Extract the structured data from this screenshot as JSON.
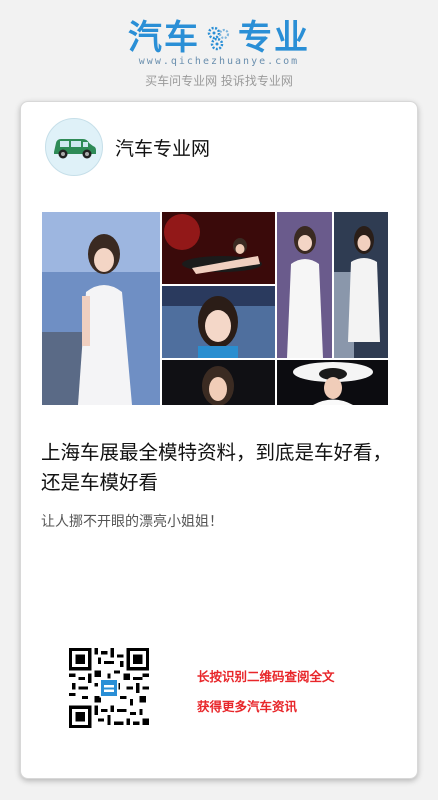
{
  "header": {
    "logo_left": "汽车",
    "logo_right": "专业",
    "domain": "www.qichezhuanye.com",
    "tagline": "买车问专业网 投诉找专业网"
  },
  "card": {
    "site_name": "汽车专业网",
    "title": "上海车展最全模特资料，到底是车好看，还是车模好看",
    "subtitle": "让人挪不开眼的漂亮小姐姐！",
    "cta_line1": "长按识别二维码查阅全文",
    "cta_line2": "获得更多汽车资讯"
  },
  "colors": {
    "brand": "#2a8fd6",
    "cta": "#e8262a",
    "avatar_car": "#2e8b57"
  },
  "icons": {
    "logo_gear": "gear-cluster-icon",
    "avatar": "car-icon",
    "qr": "qr-code"
  }
}
